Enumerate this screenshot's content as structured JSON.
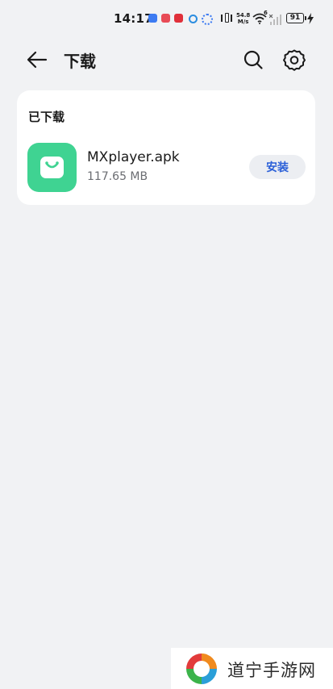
{
  "status_bar": {
    "time": "14:17",
    "net_speed_value": "54.8",
    "net_speed_unit": "M/s",
    "wifi_badge": "6",
    "battery": "91"
  },
  "header": {
    "title": "下载",
    "back_icon": "arrow-left-icon",
    "search_icon": "search-icon",
    "settings_icon": "gear-icon"
  },
  "downloads": {
    "section_title": "已下载",
    "items": [
      {
        "file_name": "MXplayer.apk",
        "size": "117.65 MB",
        "action_label": "安装",
        "icon": "shopping-bag-icon",
        "icon_color": "#3fd392"
      }
    ]
  },
  "watermark": {
    "text": "道宁手游网"
  },
  "colors": {
    "background": "#f1f2f4",
    "card": "#ffffff",
    "accent": "#2a5fd8"
  }
}
